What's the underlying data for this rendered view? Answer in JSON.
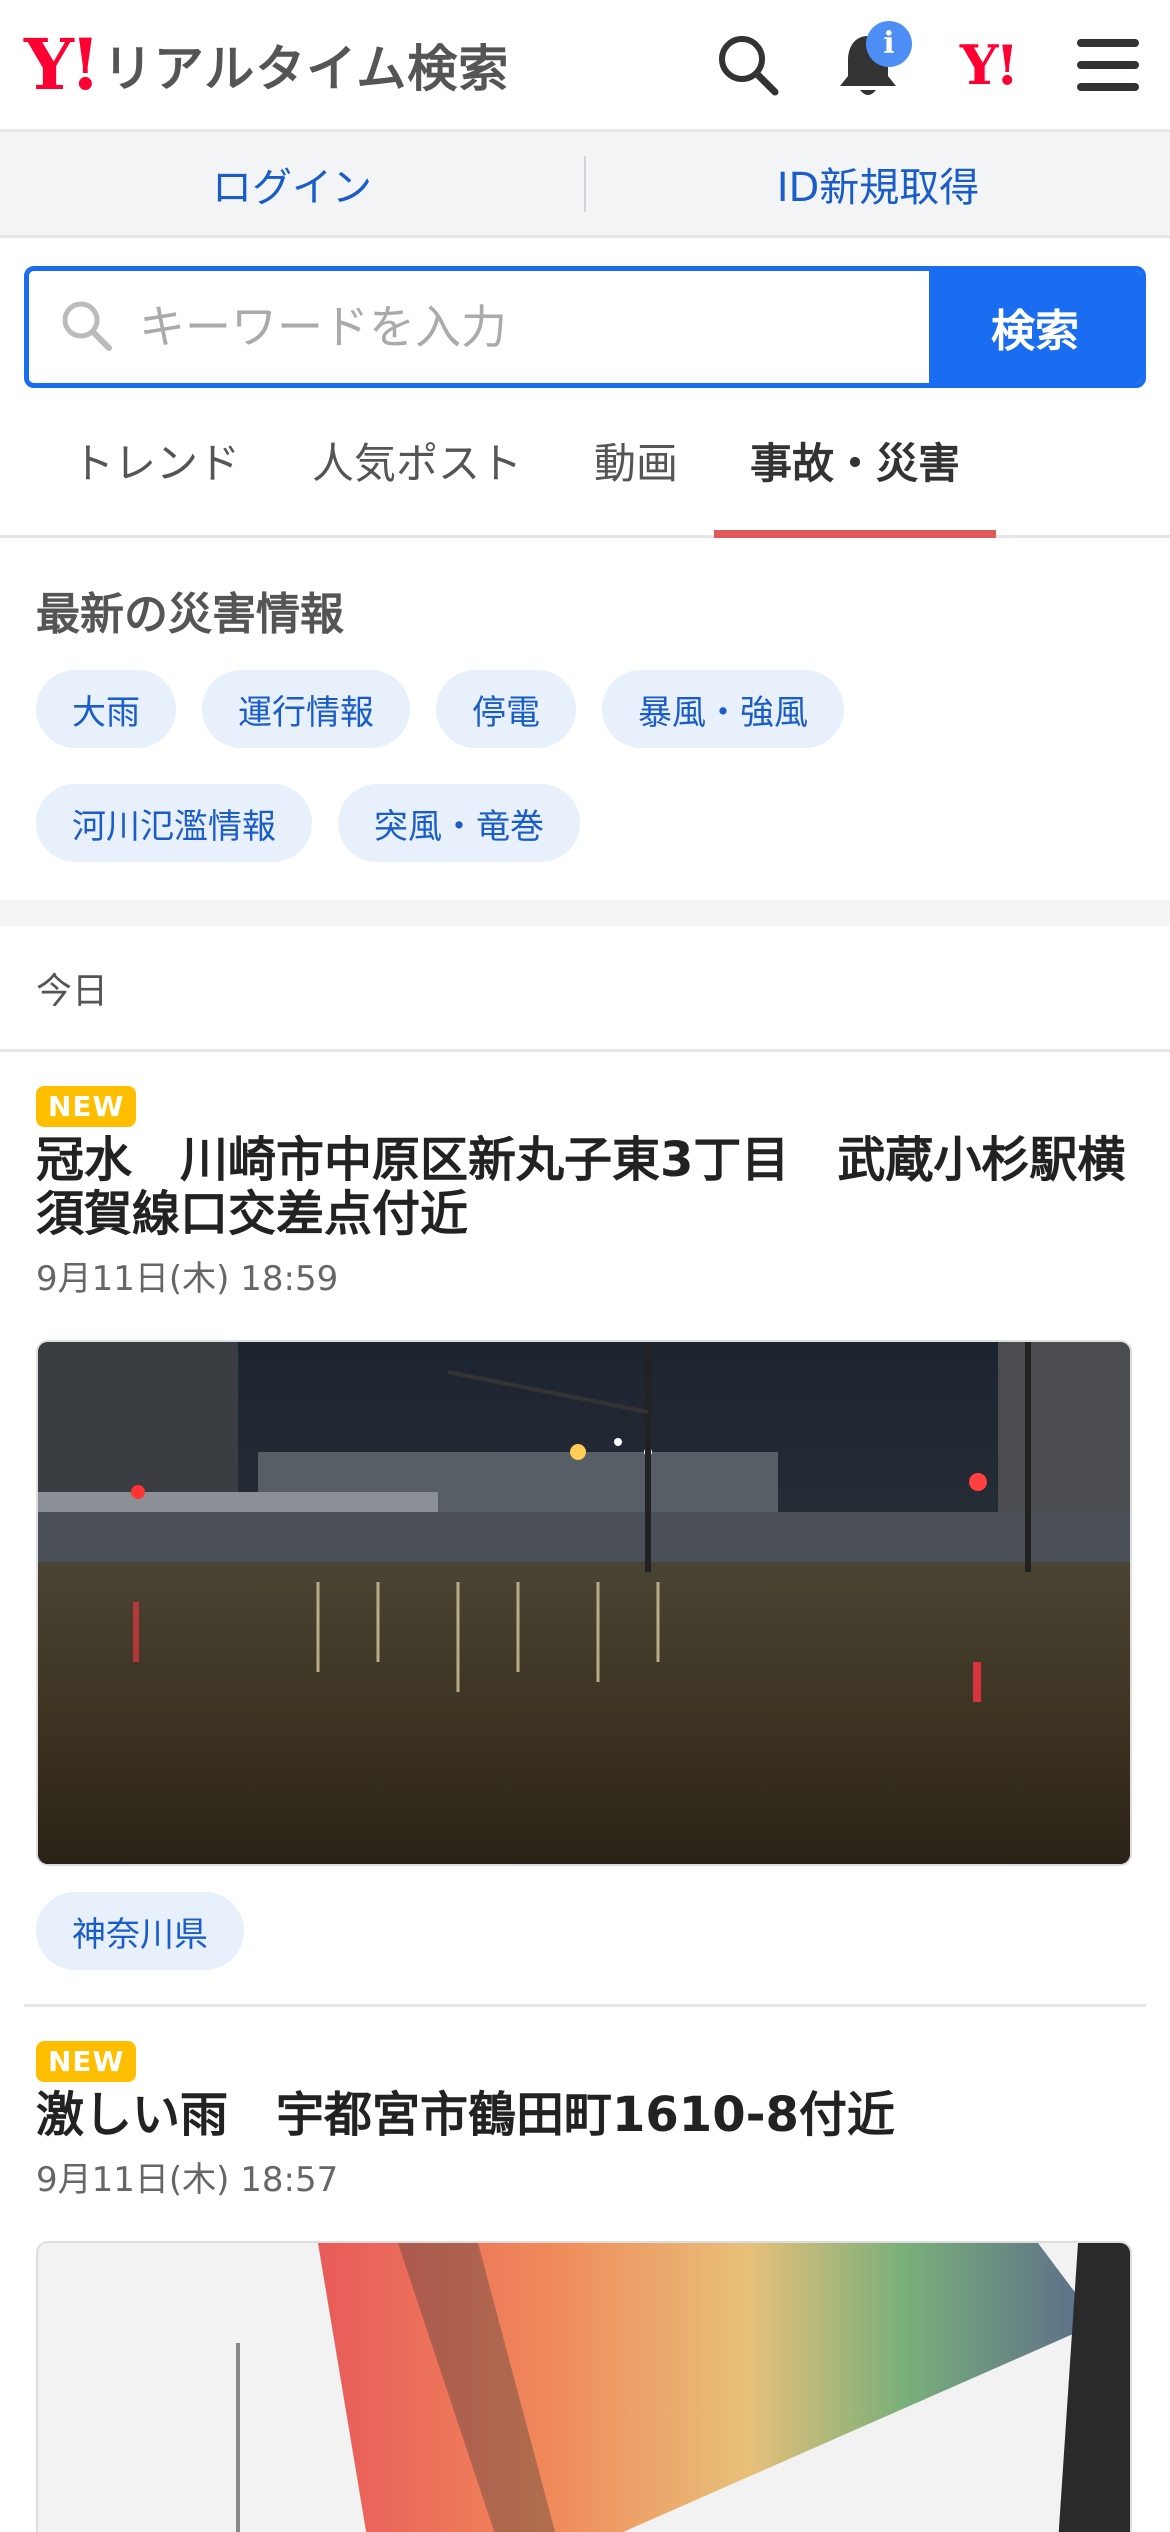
{
  "header": {
    "logo_y": "Y!",
    "logo_text": "リアルタイム検索",
    "notification_badge": "i",
    "yahoo_logo": "Y!",
    "icons": [
      "search-icon",
      "bell-icon",
      "yahoo-logo",
      "hamburger-menu-icon"
    ]
  },
  "account": {
    "login": "ログイン",
    "register": "ID新規取得"
  },
  "search": {
    "placeholder": "キーワードを入力",
    "button": "検索"
  },
  "tabs": [
    {
      "label": "トレンド",
      "active": false
    },
    {
      "label": "人気ポスト",
      "active": false
    },
    {
      "label": "動画",
      "active": false
    },
    {
      "label": "事故・災害",
      "active": true
    }
  ],
  "disaster": {
    "heading": "最新の災害情報",
    "chips": [
      "大雨",
      "運行情報",
      "停電",
      "暴風・強風",
      "河川氾濫情報",
      "突風・竜巻"
    ]
  },
  "day_label": "今日",
  "posts": [
    {
      "badge": "NEW",
      "title": "冠水　川崎市中原区新丸子東3丁目　武蔵小杉駅横須賀線口交差点付近",
      "time": "9月11日(木) 18:59",
      "tag": "神奈川県"
    },
    {
      "badge": "NEW",
      "title": "激しい雨　宇都宮市鶴田町1610-8付近",
      "time": "9月11日(木) 18:57"
    }
  ],
  "colors": {
    "accent": "#1a6cf0",
    "brand_red": "#ff0033",
    "new_badge": "#ffbf00",
    "active_tab_underline": "#e05a5a"
  }
}
